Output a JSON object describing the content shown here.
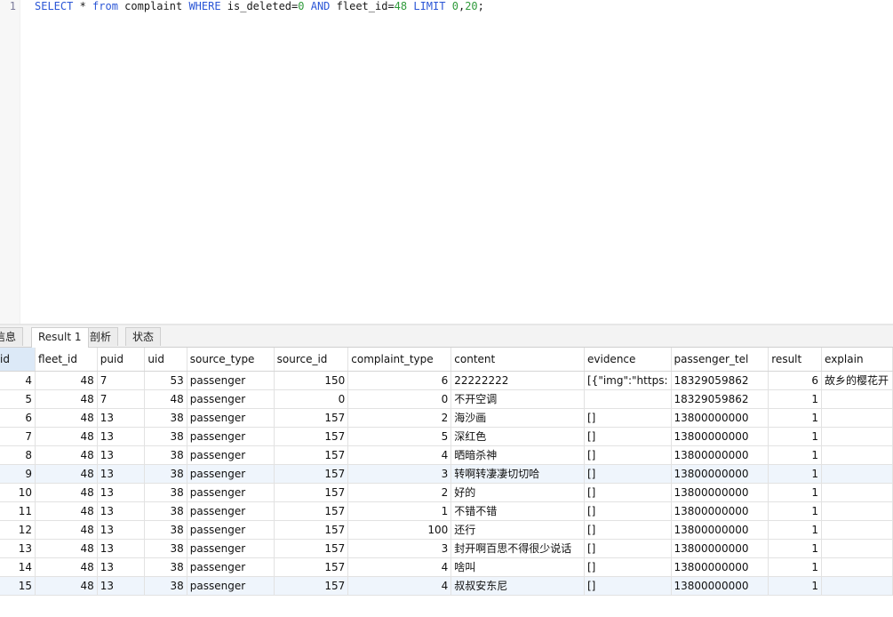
{
  "editor": {
    "line_number": "1",
    "sql": {
      "select": "SELECT",
      "star": " * ",
      "from": "from",
      "table": " complaint ",
      "where": "WHERE",
      "cond1": " is_deleted=",
      "zero": "0",
      "space1": " ",
      "and": "AND",
      "cond2": " fleet_id=",
      "fleet": "48",
      "space2": " ",
      "limit": "LIMIT",
      "space3": " ",
      "offset": "0",
      "comma": ",",
      "count": "20",
      "semi": ";"
    }
  },
  "tabs": [
    {
      "label": "信息"
    },
    {
      "label": "Result 1"
    },
    {
      "label": "剖析"
    },
    {
      "label": "状态"
    }
  ],
  "grid": {
    "columns": [
      "id",
      "fleet_id",
      "puid",
      "uid",
      "source_type",
      "source_id",
      "complaint_type",
      "content",
      "evidence",
      "passenger_tel",
      "result",
      "explain"
    ],
    "rows": [
      [
        "4",
        "48",
        "7",
        "53",
        "passenger",
        "150",
        "6",
        "22222222",
        "[{\"img\":\"https:",
        "18329059862",
        "6",
        "故乡的樱花开"
      ],
      [
        "5",
        "48",
        "7",
        "48",
        "passenger",
        "0",
        "0",
        "不开空调",
        "",
        "18329059862",
        "1",
        ""
      ],
      [
        "6",
        "48",
        "13",
        "38",
        "passenger",
        "157",
        "2",
        "海沙画",
        "[]",
        "13800000000",
        "1",
        ""
      ],
      [
        "7",
        "48",
        "13",
        "38",
        "passenger",
        "157",
        "5",
        "深红色",
        "[]",
        "13800000000",
        "1",
        ""
      ],
      [
        "8",
        "48",
        "13",
        "38",
        "passenger",
        "157",
        "4",
        "晒暗杀神",
        "[]",
        "13800000000",
        "1",
        ""
      ],
      [
        "9",
        "48",
        "13",
        "38",
        "passenger",
        "157",
        "3",
        "转啊转凄凄切切哈",
        "[]",
        "13800000000",
        "1",
        ""
      ],
      [
        "10",
        "48",
        "13",
        "38",
        "passenger",
        "157",
        "2",
        "好的",
        "[]",
        "13800000000",
        "1",
        ""
      ],
      [
        "11",
        "48",
        "13",
        "38",
        "passenger",
        "157",
        "1",
        "不错不错",
        "[]",
        "13800000000",
        "1",
        ""
      ],
      [
        "12",
        "48",
        "13",
        "38",
        "passenger",
        "157",
        "100",
        "还行",
        "[]",
        "13800000000",
        "1",
        ""
      ],
      [
        "13",
        "48",
        "13",
        "38",
        "passenger",
        "157",
        "3",
        "封开啊百思不得很少说话",
        "[]",
        "13800000000",
        "1",
        ""
      ],
      [
        "14",
        "48",
        "13",
        "38",
        "passenger",
        "157",
        "4",
        "啥叫",
        "[]",
        "13800000000",
        "1",
        ""
      ],
      [
        "15",
        "48",
        "13",
        "38",
        "passenger",
        "157",
        "4",
        "叔叔安东尼",
        "[]",
        "13800000000",
        "1",
        ""
      ]
    ]
  },
  "colors": {
    "keyword": "#2b56d6",
    "number": "#2f9a3a",
    "selected_header": "#dce9f7",
    "alt_row": "#eff5fc"
  }
}
